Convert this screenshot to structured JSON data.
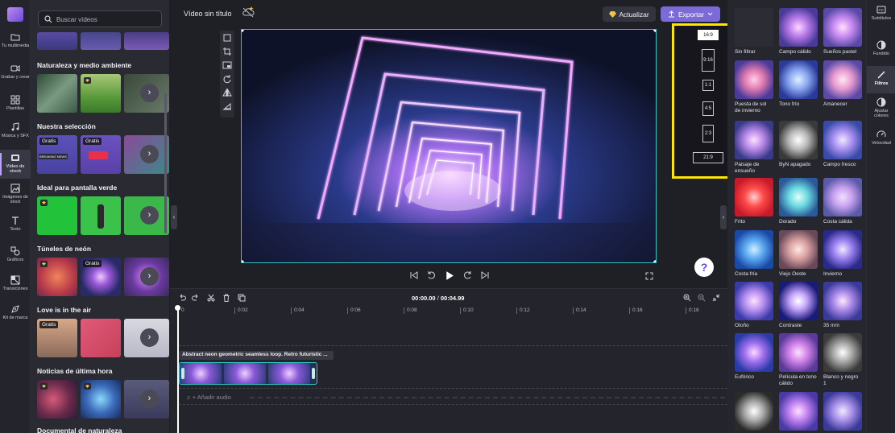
{
  "rail": {
    "items": [
      {
        "label": "Tu multimedia",
        "icon": "folder-icon"
      },
      {
        "label": "Grabar y crear",
        "icon": "camera-icon"
      },
      {
        "label": "Plantillas",
        "icon": "templates-icon"
      },
      {
        "label": "Música y SFX",
        "icon": "music-note-icon"
      },
      {
        "label": "Vídeo de stock",
        "icon": "film-icon",
        "active": true
      },
      {
        "label": "Imágenes de stock",
        "icon": "image-icon"
      },
      {
        "label": "Texto",
        "icon": "text-icon"
      },
      {
        "label": "Gráficos",
        "icon": "shapes-icon"
      },
      {
        "label": "Transiciones",
        "icon": "transitions-icon"
      },
      {
        "label": "Kit de marca",
        "icon": "brand-kit-icon"
      }
    ]
  },
  "panel": {
    "search_placeholder": "Buscar vídeos",
    "badge_free": "Gratis",
    "categories": [
      "Naturaleza y medio ambiente",
      "Nuestra selección",
      "Ideal para pantalla verde",
      "Túneles de neón",
      "Love is in the air",
      "Noticias de última hora",
      "Documental de naturaleza"
    ],
    "thumb_text": {
      "breaking_news": "BREAKING NEWS"
    }
  },
  "header": {
    "project_title": "Vídeo sin título",
    "upgrade_label": "Actualizar",
    "export_label": "Exportar"
  },
  "ratios": [
    "16:9",
    "9:16",
    "1:1",
    "4:5",
    "2:3",
    "21:9"
  ],
  "selected_ratio": "16:9",
  "timeline": {
    "current_time": "00:00.00",
    "total_time": "00:04.99",
    "ticks": [
      "0",
      "0:02",
      "0:04",
      "0:06",
      "0:08",
      "0:10",
      "0:12",
      "0:14",
      "0:16",
      "0:18"
    ],
    "clip_label": "Abstract neon geometric seamless loop. Retro futuristic ...",
    "audio_label": "Añadir audio"
  },
  "filters": [
    "Sin filtrar",
    "Campo cálido",
    "Sueños pastel",
    "Puesta de sol de invierno",
    "Tono frío",
    "Amanecer",
    "Paisaje de ensueño",
    "ByN apagado",
    "Campo fresco",
    "Frito",
    "Dorado",
    "Costa cálida",
    "Costa fría",
    "Viejo Oeste",
    "Invierno",
    "Otoño",
    "Contraste",
    "35 mm",
    "Eufórico",
    "Película en tono cálido",
    "Blanco y negro 1",
    "",
    "",
    ""
  ],
  "right_rail": [
    {
      "label": "Subtítulos",
      "icon": "captions-icon"
    },
    {
      "label": "Fundido",
      "icon": "fade-icon"
    },
    {
      "label": "Filtros",
      "icon": "magic-wand-icon",
      "active": true
    },
    {
      "label": "Ajustar colores",
      "icon": "color-adjust-icon"
    },
    {
      "label": "Velocidad",
      "icon": "speed-icon"
    }
  ],
  "colors": {
    "accent": "#7b6ad8",
    "selection": "#2cc7c2",
    "highlight": "#ffe600"
  }
}
